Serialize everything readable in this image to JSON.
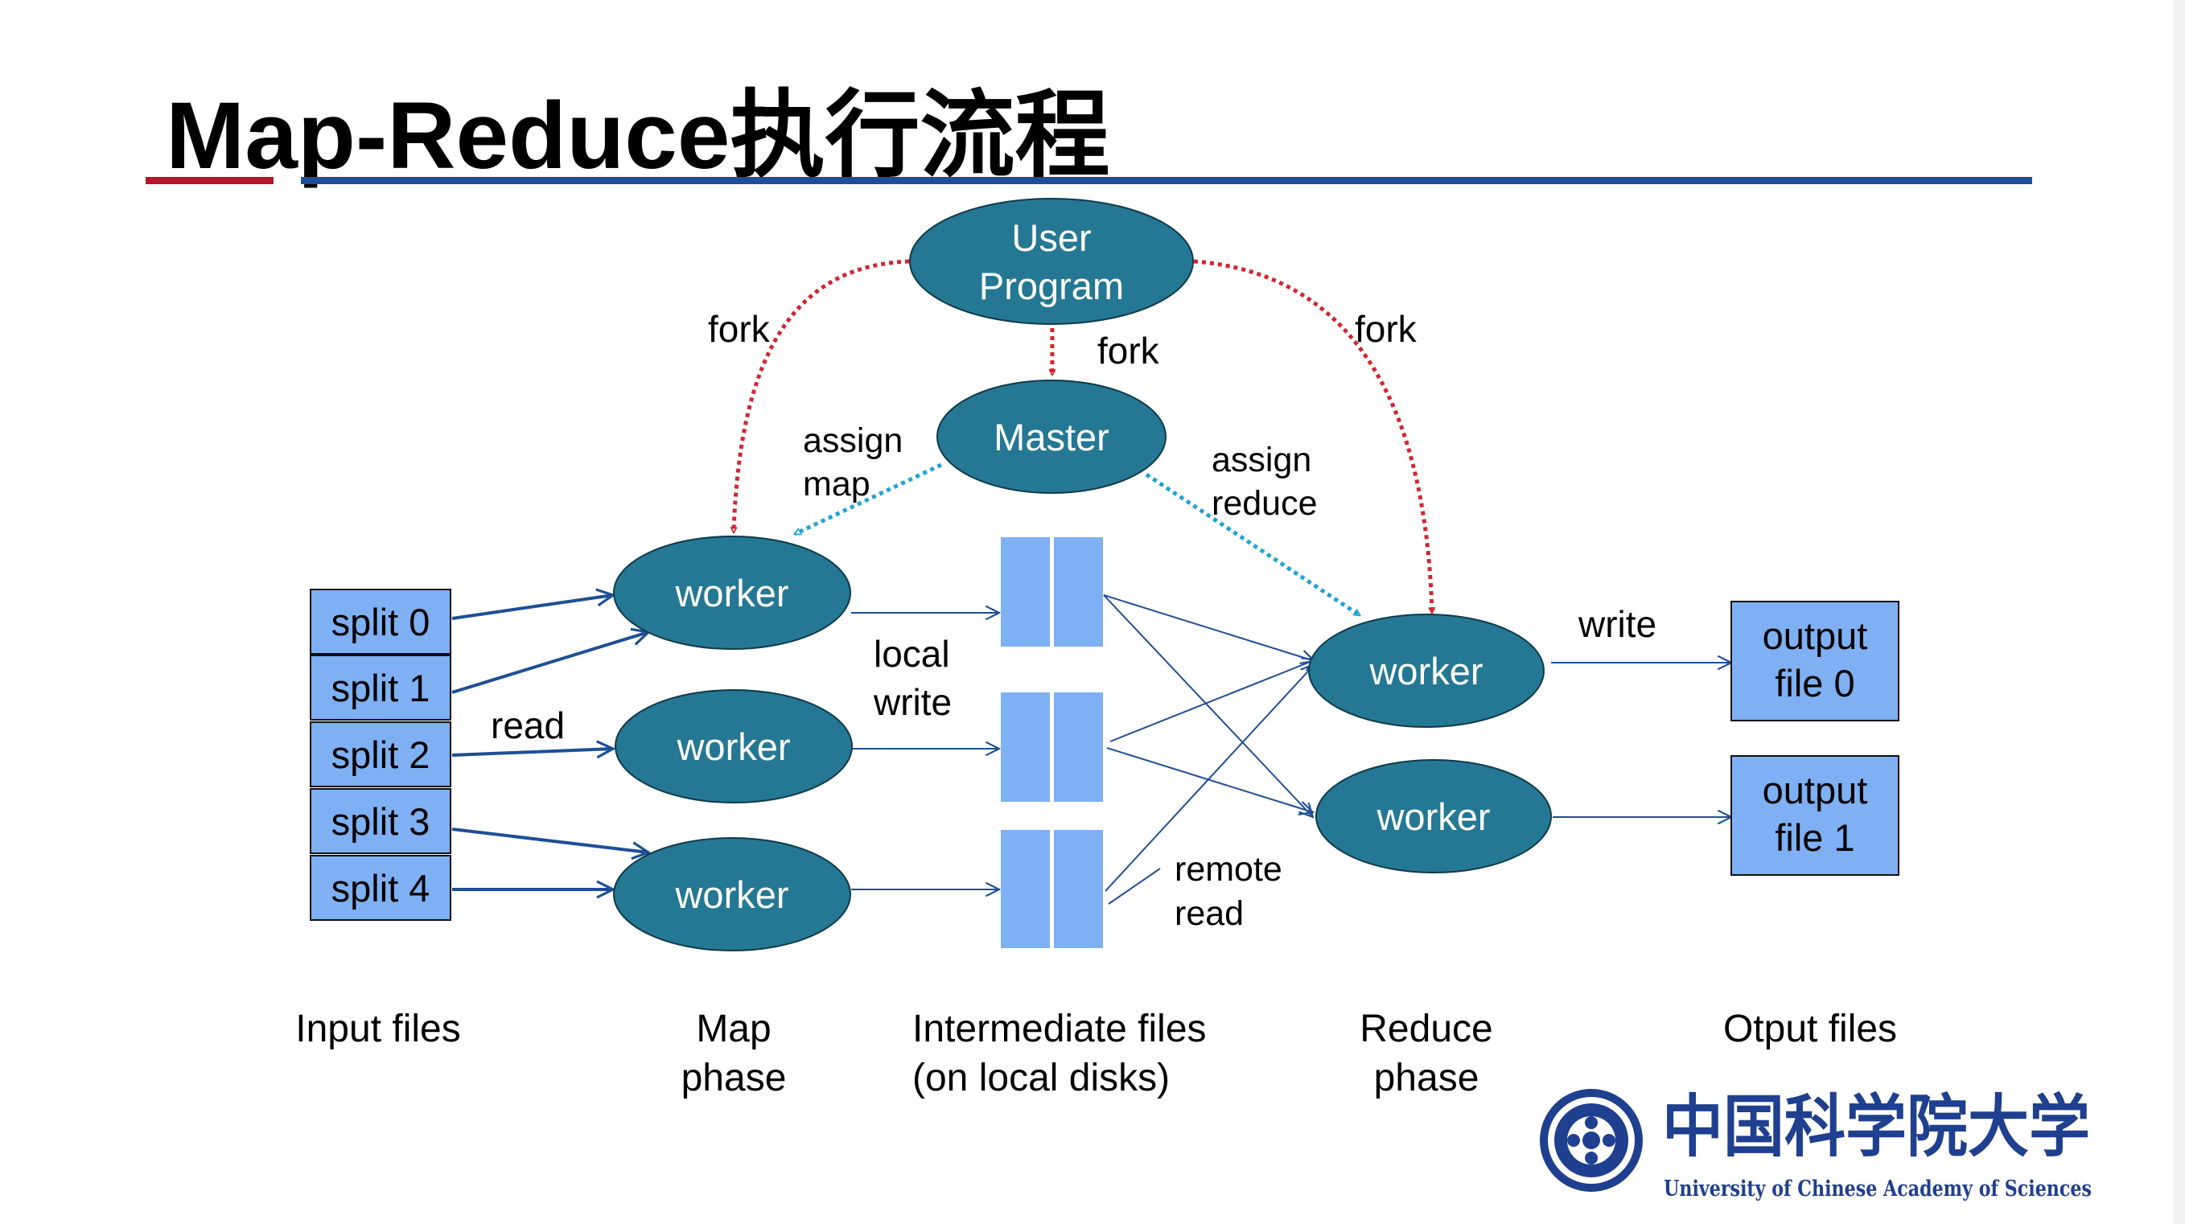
{
  "title": "Map-Reduce执行流程",
  "nodes": {
    "user_program": [
      "User",
      "Program"
    ],
    "master": "Master",
    "worker": "worker"
  },
  "splits": [
    "split 0",
    "split 1",
    "split 2",
    "split 3",
    "split 4"
  ],
  "outputs": [
    [
      "output",
      "file 0"
    ],
    [
      "output",
      "file 1"
    ]
  ],
  "labels": {
    "fork": "fork",
    "assign_map": [
      "assign",
      "map"
    ],
    "assign_reduce": [
      "assign",
      "reduce"
    ],
    "read": "read",
    "local_write": [
      "local",
      "write"
    ],
    "remote_read": [
      "remote",
      "read"
    ],
    "write": "write"
  },
  "captions": {
    "input": [
      "Input files"
    ],
    "map": [
      "Map",
      "phase"
    ],
    "intermediate": [
      "Intermediate files",
      "(on local disks)"
    ],
    "reduce": [
      "Reduce",
      "phase"
    ],
    "output": [
      "Otput files"
    ]
  },
  "logo": {
    "name_cn": "中国科学院大学",
    "name_en": "University of  Chinese Academy of Sciences"
  },
  "colors": {
    "node_fill": "#247894",
    "box_fill": "#7eb0f3",
    "fork_arrow": "#d22630",
    "assign_arrow": "#21a3d6",
    "data_arrow": "#1e4f96",
    "title_red": "#b0182a",
    "title_blue": "#1f4e96"
  }
}
